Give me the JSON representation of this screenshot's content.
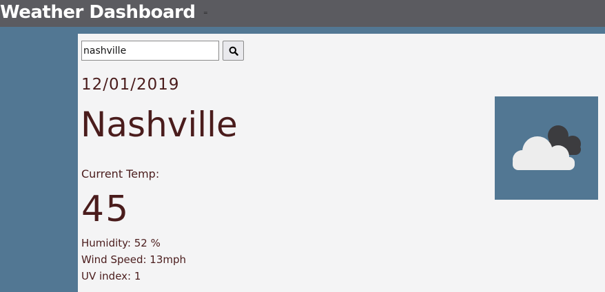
{
  "header": {
    "title": "Weather Dashboard",
    "tiny_mark": "="
  },
  "search": {
    "value": "nashville",
    "button_icon": "search-icon"
  },
  "weather": {
    "date": "12/01/2019",
    "city": "Nashville",
    "current_temp_label": "Current Temp:",
    "current_temp": "45",
    "humidity": "Humidity: 52 %",
    "wind_speed": "Wind Speed: 13mph",
    "uv_index": "UV index: 1",
    "icon": "cloudy-icon"
  },
  "colors": {
    "background": "#527793",
    "header": "#5b5b60",
    "panel": "#f4f4f5",
    "text": "#4a1c1c"
  }
}
